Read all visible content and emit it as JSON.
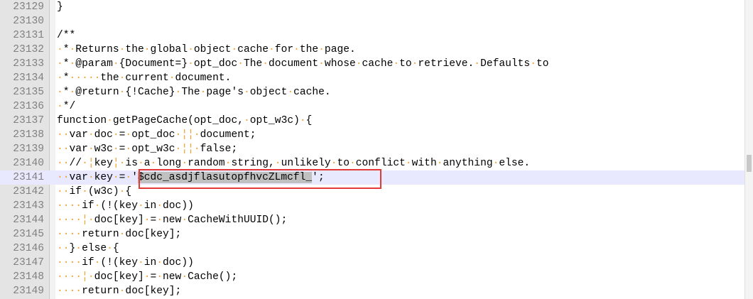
{
  "editor": {
    "first_line": 23129,
    "current_line": 23141,
    "selection_text": "$cdc_asdjflasutopfhvcZLmcfl_",
    "lines": [
      "}",
      "",
      "/**",
      "·*·Returns·the·global·object·cache·for·the·page.",
      "·*·@param·{Document=}·opt_doc·The·document·whose·cache·to·retrieve.·Defaults·to",
      "·*·····the·current·document.",
      "·*·@return·{!Cache}·The·page's·object·cache.",
      "·*/",
      "function·getPageCache(opt_doc,·opt_w3c)·{",
      "··var·doc·=·opt_doc·||·document;",
      "··var·w3c·=·opt_w3c·||·false;",
      "··//·|key|·is·a·long·random·string,·unlikely·to·conflict·with·anything·else.",
      "··var·key·=·'$cdc_asdjflasutopfhvcZLmcfl_';",
      "··if·(w3c)·{",
      "····if·(!(key·in·doc))",
      "····|·doc[key]·=·new·CacheWithUUID();",
      "····return·doc[key];",
      "··}·else·{",
      "····if·(!(key·in·doc))",
      "····|·doc[key]·=·new·Cache();",
      "····return·doc[key];"
    ]
  }
}
